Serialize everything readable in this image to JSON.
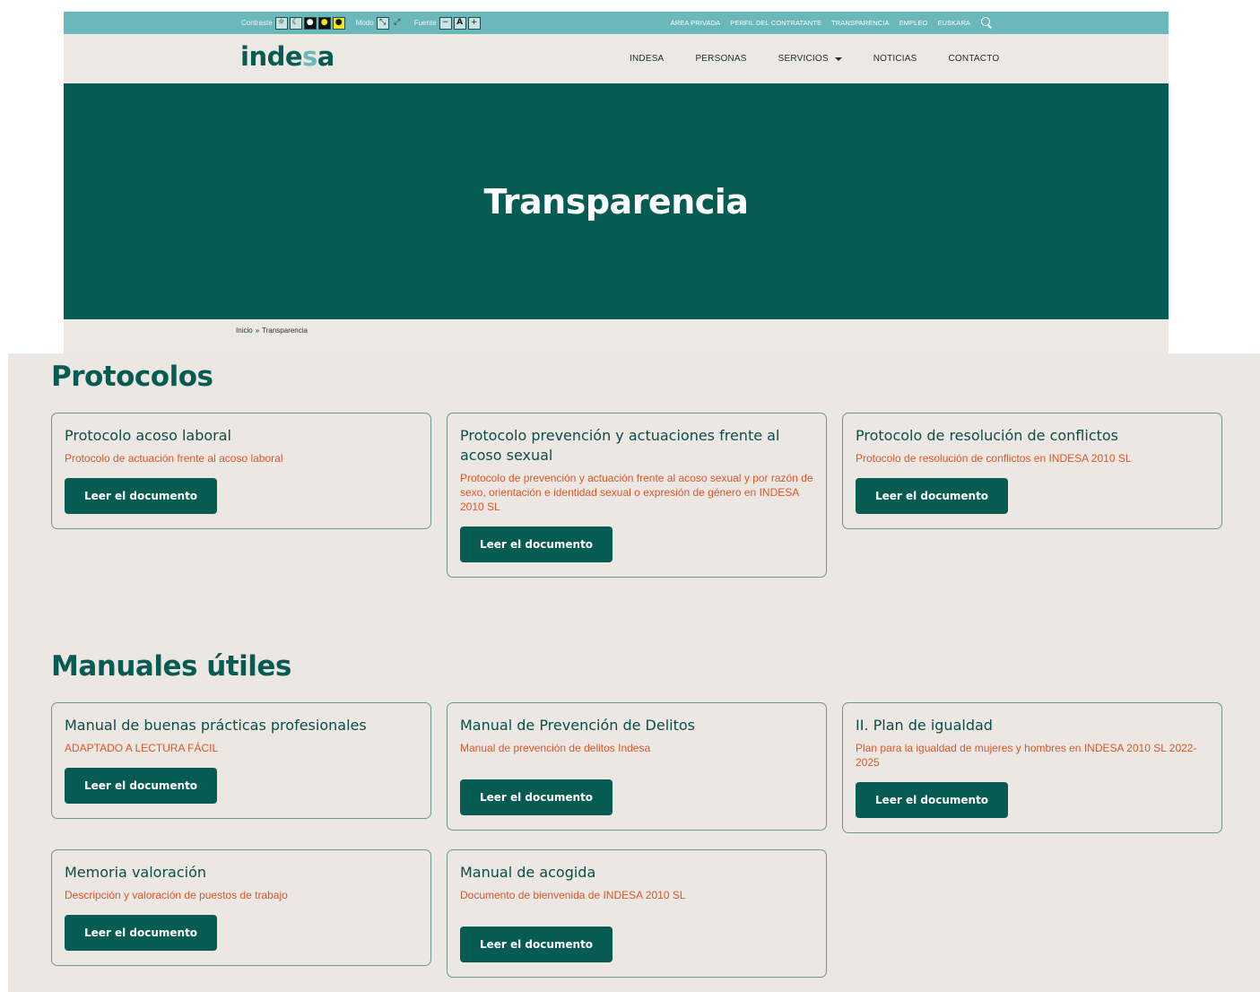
{
  "topbar": {
    "contrast_label": "Contraste",
    "mode_label": "Modo",
    "font_label": "Fuente",
    "links": [
      "ÁREA PRIVADA",
      "PERFIL DEL CONTRATANTE",
      "TRANSPARENCIA",
      "EMPLEO",
      "EUSKARA"
    ],
    "icons": [
      "sun-icon",
      "moon-icon",
      "eye-dark-icon",
      "eye-dark-yellow-icon",
      "eye-yellow-icon",
      "mode-compress-icon",
      "mode-expand-icon",
      "search-icon"
    ],
    "font_controls": [
      "−",
      "A",
      "+"
    ]
  },
  "logo": {
    "part1": "inde",
    "part2": "s",
    "part3": "a"
  },
  "nav": {
    "items": [
      "INDESA",
      "PERSONAS",
      "SERVICIOS",
      "NOTICIAS",
      "CONTACTO"
    ]
  },
  "hero": {
    "title": "Transparencia"
  },
  "breadcrumb": {
    "home": "Inicio",
    "sep": "»",
    "current": "Transparencia"
  },
  "sections": [
    {
      "title": "Protocolos",
      "cards": [
        {
          "title": "Protocolo acoso laboral",
          "desc": "Protocolo de actuación frente al acoso laboral",
          "button": "Leer el documento"
        },
        {
          "title": "Protocolo prevención y actuaciones frente al acoso sexual",
          "desc": "Protocolo de prevención y actuación frente al acoso sexual y por razón de sexo, orientación e identidad sexual o expresión de género en INDESA 2010 SL",
          "button": "Leer el documento"
        },
        {
          "title": "Protocolo de resolución de conflictos",
          "desc": "Protocolo de resolución de conflictos en INDESA 2010 SL",
          "button": "Leer el documento"
        }
      ]
    },
    {
      "title": "Manuales útiles",
      "cards": [
        {
          "title": "Manual de buenas prácticas profesionales",
          "desc": "ADAPTADO A LECTURA FÁCIL",
          "button": "Leer el documento"
        },
        {
          "title": "Manual de Prevención de Delitos",
          "desc": "Manual de prevención de delitos Indesa",
          "button": "Leer el documento"
        },
        {
          "title": "II. Plan de igualdad",
          "desc": "Plan para la igualdad de mujeres y hombres en INDESA 2010 SL 2022-2025",
          "button": "Leer el documento"
        },
        {
          "title": "Memoria valoración",
          "desc": "Descripción y valoración de puestos de trabajo",
          "button": "Leer el documento"
        },
        {
          "title": "Manual de acogida",
          "desc": "Documento de bienvenida de INDESA 2010 SL",
          "button": "Leer el documento"
        }
      ]
    }
  ],
  "colors": {
    "brand_green": "#065b52",
    "topbar_teal": "#6bb8bb",
    "beige_bg": "#ece7e2",
    "accent_orange": "#d8582a"
  }
}
